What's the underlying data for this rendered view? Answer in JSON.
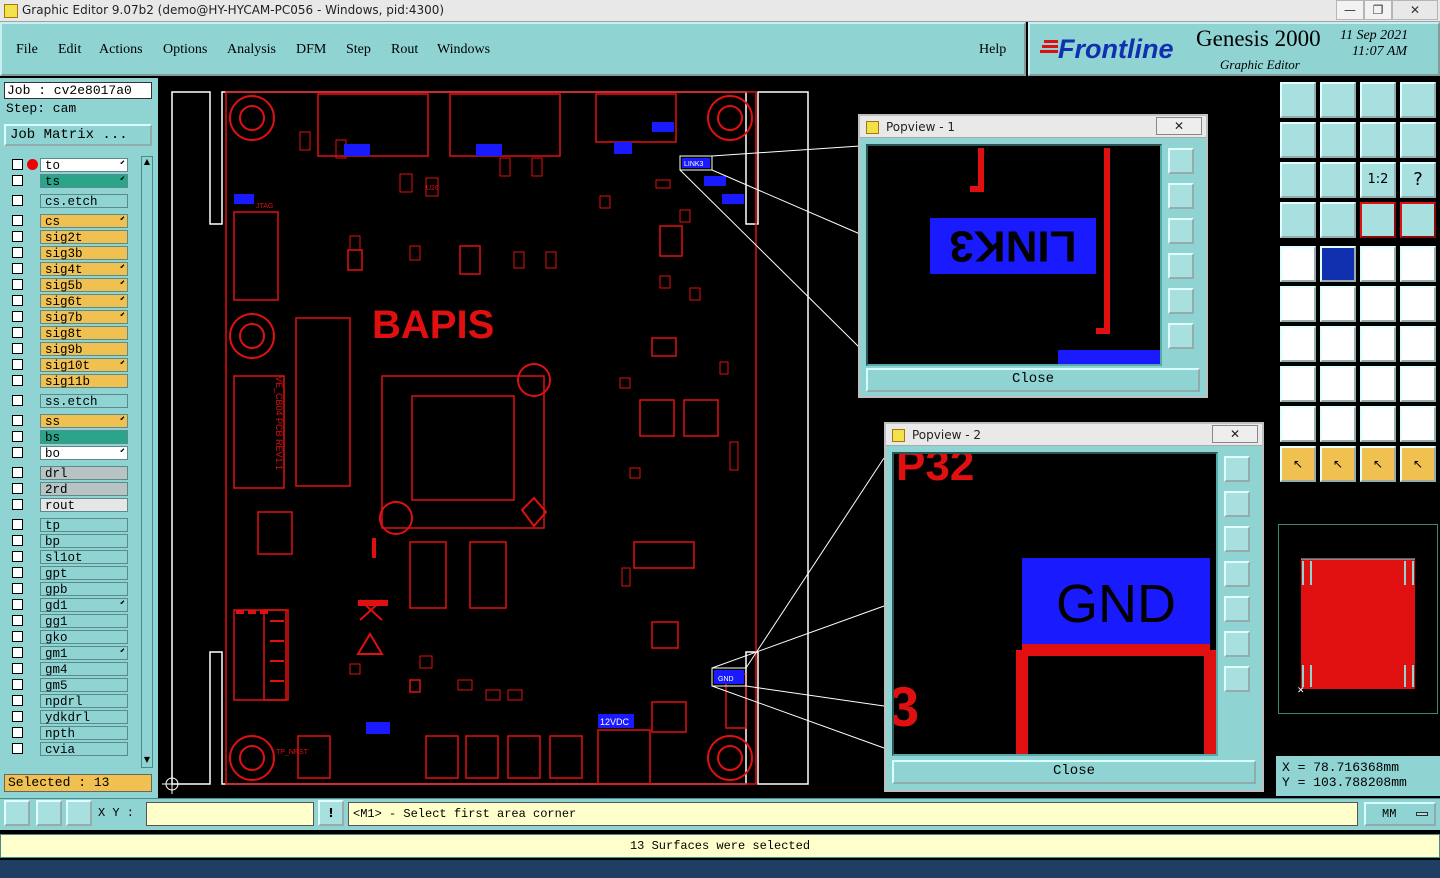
{
  "window": {
    "title": "Graphic Editor 9.07b2 (demo@HY-HYCAM-PC056 - Windows, pid:4300)",
    "minimize": "—",
    "restore": "❐",
    "close": "✕"
  },
  "menu": {
    "file": "File",
    "edit": "Edit",
    "actions": "Actions",
    "options": "Options",
    "analysis": "Analysis",
    "dfm": "DFM",
    "step": "Step",
    "rout": "Rout",
    "windows": "Windows",
    "help": "Help"
  },
  "brand": {
    "logo": "Frontline",
    "product": "Genesis 2000",
    "subtitle": "Graphic Editor",
    "date": "11 Sep 2021",
    "time": "11:07 AM"
  },
  "job": {
    "job_label": "Job : cv2e8017a0",
    "step_label": "Step: cam",
    "matrix_button": "Job Matrix ..."
  },
  "layers": [
    {
      "name": "to",
      "color": "#ffffff",
      "arrow": true,
      "dot": true
    },
    {
      "name": "ts",
      "color": "#2aa58a",
      "arrow": true,
      "dot": false
    },
    {
      "name": "cs.etch",
      "color": "#8fd3d3",
      "arrow": false,
      "dot": false
    },
    {
      "name": "cs",
      "color": "#f0c050",
      "arrow": true,
      "dot": false
    },
    {
      "name": "sig2t",
      "color": "#f0c050",
      "arrow": false,
      "dot": false
    },
    {
      "name": "sig3b",
      "color": "#f0c050",
      "arrow": false,
      "dot": false
    },
    {
      "name": "sig4t",
      "color": "#f0c050",
      "arrow": true,
      "dot": false
    },
    {
      "name": "sig5b",
      "color": "#f0c050",
      "arrow": true,
      "dot": false
    },
    {
      "name": "sig6t",
      "color": "#f0c050",
      "arrow": true,
      "dot": false
    },
    {
      "name": "sig7b",
      "color": "#f0c050",
      "arrow": true,
      "dot": false
    },
    {
      "name": "sig8t",
      "color": "#f0c050",
      "arrow": false,
      "dot": false
    },
    {
      "name": "sig9b",
      "color": "#f0c050",
      "arrow": false,
      "dot": false
    },
    {
      "name": "sig10t",
      "color": "#f0c050",
      "arrow": true,
      "dot": false
    },
    {
      "name": "sig11b",
      "color": "#f0c050",
      "arrow": false,
      "dot": false
    },
    {
      "name": "ss.etch",
      "color": "#8fd3d3",
      "arrow": false,
      "dot": false
    },
    {
      "name": "ss",
      "color": "#f0c050",
      "arrow": true,
      "dot": false
    },
    {
      "name": "bs",
      "color": "#2aa58a",
      "arrow": false,
      "dot": false
    },
    {
      "name": "bo",
      "color": "#ffffff",
      "arrow": true,
      "dot": false
    },
    {
      "name": "drl",
      "color": "#b8c4c4",
      "arrow": false,
      "dot": false
    },
    {
      "name": "2rd",
      "color": "#b8c4c4",
      "arrow": false,
      "dot": false
    },
    {
      "name": "rout",
      "color": "#e6e6e6",
      "arrow": false,
      "dot": false
    },
    {
      "name": "tp",
      "color": "#8fd3d3",
      "arrow": false,
      "dot": false
    },
    {
      "name": "bp",
      "color": "#8fd3d3",
      "arrow": false,
      "dot": false
    },
    {
      "name": "sl1ot",
      "color": "#8fd3d3",
      "arrow": false,
      "dot": false
    },
    {
      "name": "gpt",
      "color": "#8fd3d3",
      "arrow": false,
      "dot": false
    },
    {
      "name": "gpb",
      "color": "#8fd3d3",
      "arrow": false,
      "dot": false
    },
    {
      "name": "gd1",
      "color": "#8fd3d3",
      "arrow": true,
      "dot": false
    },
    {
      "name": "gg1",
      "color": "#8fd3d3",
      "arrow": false,
      "dot": false
    },
    {
      "name": "gko",
      "color": "#8fd3d3",
      "arrow": false,
      "dot": false
    },
    {
      "name": "gm1",
      "color": "#8fd3d3",
      "arrow": true,
      "dot": false
    },
    {
      "name": "gm4",
      "color": "#8fd3d3",
      "arrow": false,
      "dot": false
    },
    {
      "name": "gm5",
      "color": "#8fd3d3",
      "arrow": false,
      "dot": false
    },
    {
      "name": "npdrl",
      "color": "#8fd3d3",
      "arrow": false,
      "dot": false
    },
    {
      "name": "ydkdrl",
      "color": "#8fd3d3",
      "arrow": false,
      "dot": false
    },
    {
      "name": "npth",
      "color": "#8fd3d3",
      "arrow": false,
      "dot": false
    },
    {
      "name": "cvia",
      "color": "#8fd3d3",
      "arrow": false,
      "dot": false
    }
  ],
  "selected": "Selected : 13",
  "board": {
    "title": "BAPIS",
    "vertical_label": "VE_CB04 PCB REV1.1",
    "labels": {
      "jtag": "JTAG",
      "v12": "12VDC",
      "gnd": "GND",
      "link3": "LINK3",
      "tp_nrst": "TP_NRST",
      "u26": "U26"
    }
  },
  "popview1": {
    "title": "Popview - 1",
    "text": "LINK3",
    "close": "Close",
    "x": "✕"
  },
  "popview2": {
    "title": "Popview - 2",
    "top_text": "P32",
    "text": "GND",
    "side_text": "3",
    "close": "Close",
    "x": "✕"
  },
  "coords": {
    "x": "X = 78.716368mm",
    "y": "Y = 103.788208mm"
  },
  "cmd": {
    "xy_label": "X Y :",
    "info": "!",
    "prompt": "<M1> - Select first area corner",
    "units": "MM"
  },
  "status": "13 Surfaces were selected",
  "colors": {
    "teal": "#8fd3d3",
    "board_red": "#e01010",
    "highlight_blue": "#1a1aff",
    "orange": "#f0c050"
  }
}
